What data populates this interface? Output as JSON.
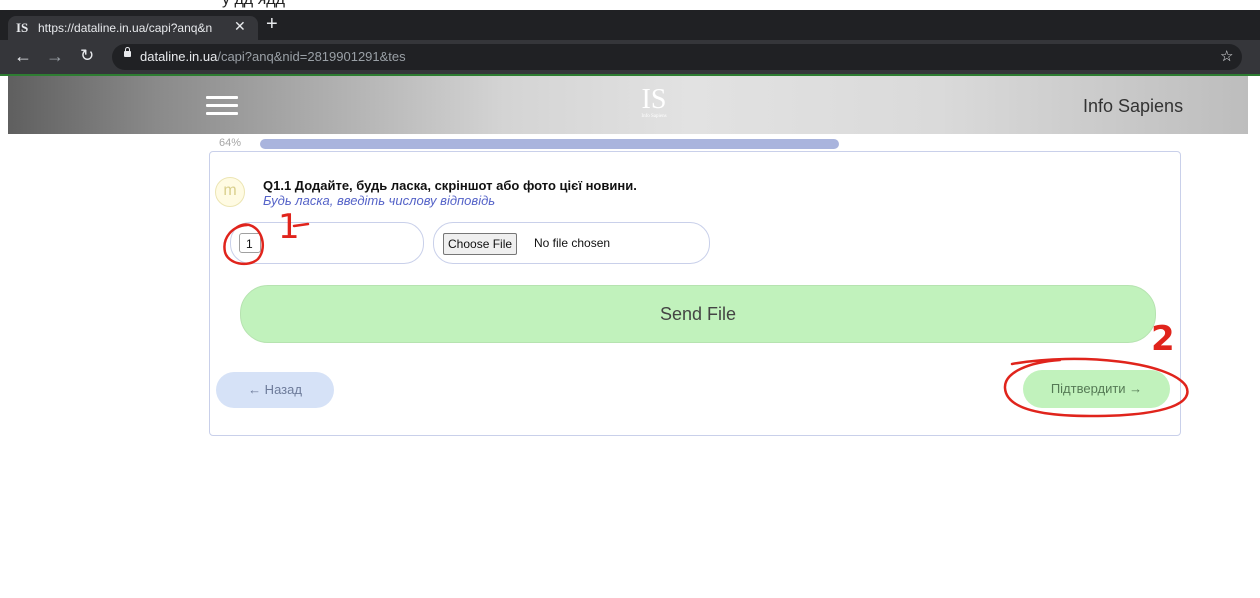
{
  "top_strip": {
    "text": "у                            дд ядд"
  },
  "browser": {
    "tab_title": "https://dataline.in.ua/capi?anq&n",
    "favicon": "IS",
    "tab_close": "✕",
    "new_tab": "+",
    "url_domain": "dataline.in.ua",
    "url_path": "/capi?anq&nid=2819901291&tes",
    "icons": [
      "back-arrow-icon",
      "forward-arrow-icon",
      "reload-icon",
      "lock-icon",
      "star-icon"
    ]
  },
  "header": {
    "logo_big": "IS",
    "logo_small": "Info Sapiens",
    "brand": "Info Sapiens"
  },
  "progress": {
    "label": "64%",
    "value": 0.64
  },
  "question": {
    "avatar": "m",
    "title": "Q1.1 Додайте, будь ласка, скріншот або фото цієї новини.",
    "hint": "Будь ласка, введіть числову відповідь",
    "number_value": "1",
    "choose_file_label": "Choose File",
    "no_file_text": "No file chosen",
    "send_file_label": "Send File"
  },
  "nav": {
    "back_label": "← Назад",
    "confirm_label": "Підтвердити →"
  },
  "annotations": {
    "mark_1": "1",
    "mark_2": "2"
  },
  "colors": {
    "send_green": "#c1f2bc",
    "progress": "#a9b4dd",
    "hint_blue": "#5563c8",
    "annotation_red": "#e0241c"
  }
}
